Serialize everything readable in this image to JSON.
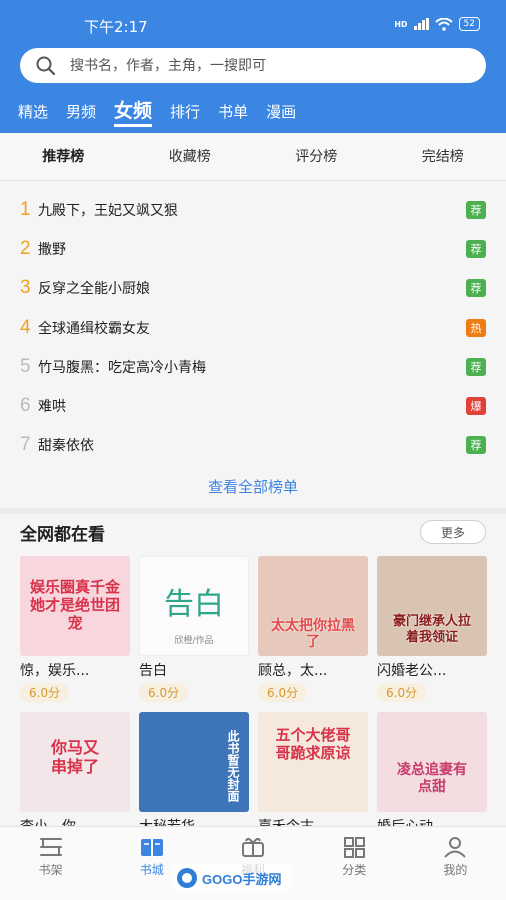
{
  "status": {
    "time": "下午2:17",
    "network": "HD",
    "battery": "52"
  },
  "search": {
    "placeholder": "搜书名，作者，主角，一搜即可"
  },
  "category_tabs": [
    {
      "label": "精选"
    },
    {
      "label": "男频"
    },
    {
      "label": "女频",
      "active": true
    },
    {
      "label": "排行"
    },
    {
      "label": "书单"
    },
    {
      "label": "漫画"
    }
  ],
  "rank_tabs": [
    {
      "label": "推荐榜",
      "active": true
    },
    {
      "label": "收藏榜"
    },
    {
      "label": "评分榜"
    },
    {
      "label": "完结榜"
    }
  ],
  "ranking": [
    {
      "rank": "1",
      "title": "九殿下，王妃又飒又狠",
      "badge": "荐",
      "badge_color": "#4caf50"
    },
    {
      "rank": "2",
      "title": "撒野",
      "badge": "荐",
      "badge_color": "#4caf50"
    },
    {
      "rank": "3",
      "title": "反穿之全能小厨娘",
      "badge": "荐",
      "badge_color": "#4caf50"
    },
    {
      "rank": "4",
      "title": "全球通缉校霸女友",
      "badge": "热",
      "badge_color": "#ef7d16"
    },
    {
      "rank": "5",
      "title": "竹马腹黑：吃定高冷小青梅",
      "badge": "荐",
      "badge_color": "#4caf50"
    },
    {
      "rank": "6",
      "title": "难哄",
      "badge": "爆",
      "badge_color": "#e0423a"
    },
    {
      "rank": "7",
      "title": "甜秦依依",
      "badge": "荐",
      "badge_color": "#4caf50"
    }
  ],
  "view_all": "查看全部榜单",
  "section": {
    "title": "全网都在看",
    "more": "更多"
  },
  "books": [
    {
      "title": "惊，娱乐...",
      "score": "6.0分",
      "cover_text": "娱乐圈真千金她才是绝世团宠",
      "cover_color": "#f7d6dd"
    },
    {
      "title": "告白",
      "score": "6.0分",
      "cover_text": "告白",
      "cover_sub": "欣橙/作品",
      "cover_color": "#fbfbfb"
    },
    {
      "title": "顾总，太...",
      "score": "6.0分",
      "cover_text": "太太把你拉黑了",
      "cover_color": "#e6c8bd"
    },
    {
      "title": "闪婚老公...",
      "score": "6.0分",
      "cover_text": "豪门继承人拉着我领证",
      "cover_color": "#d9c4b4"
    },
    {
      "title": "李小，你...",
      "cover_text": "你马又串掉了",
      "cover_color": "#f2e6e8"
    },
    {
      "title": "大秘若华...",
      "cover_text": "此书暂无封面",
      "cover_color": "#3e74b8"
    },
    {
      "title": "嘉禾今古...",
      "cover_text": "五个大佬哥哥跪求原谅",
      "cover_color": "#f5e9dd"
    },
    {
      "title": "婚后心动...",
      "cover_text": "凌总追妻有点甜",
      "cover_color": "#f4dde1"
    }
  ],
  "bottom_nav": [
    {
      "label": "书架",
      "icon": "bookshelf-icon"
    },
    {
      "label": "书城",
      "icon": "bookstore-icon",
      "active": true
    },
    {
      "label": "福利",
      "icon": "gift-icon"
    },
    {
      "label": "分类",
      "icon": "category-icon"
    },
    {
      "label": "我的",
      "icon": "profile-icon"
    }
  ],
  "watermark": "GOGO手游网",
  "colors": {
    "primary": "#3b86e3",
    "rank_top": "#f0a224",
    "score": "#d79a2e"
  }
}
